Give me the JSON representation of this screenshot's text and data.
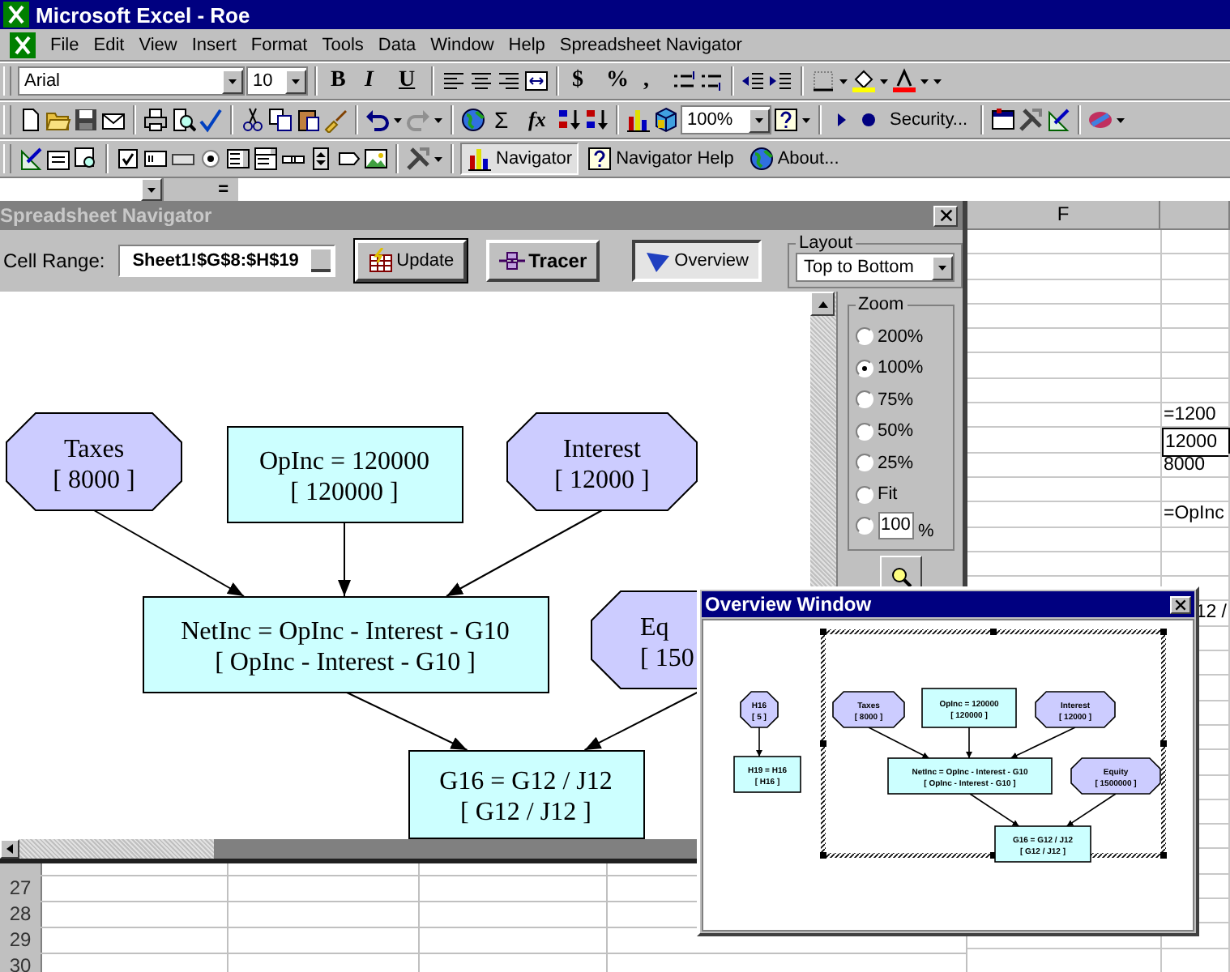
{
  "window": {
    "title": "Microsoft Excel - Roe"
  },
  "menu": [
    "File",
    "Edit",
    "View",
    "Insert",
    "Format",
    "Tools",
    "Data",
    "Window",
    "Help",
    "Spreadsheet Navigator"
  ],
  "toolbars": [
    {
      "items": [
        {
          "kind": "combo",
          "value": "Arial"
        },
        {
          "kind": "combo",
          "value": "10"
        },
        {
          "kind": "button",
          "label": "B"
        },
        {
          "kind": "button",
          "label": "I"
        },
        {
          "kind": "button",
          "label": "U"
        },
        {
          "kind": "button",
          "label": "$"
        },
        {
          "kind": "button",
          "label": "%"
        },
        {
          "kind": "button",
          "label": ","
        }
      ]
    },
    {
      "items": [
        {
          "kind": "button",
          "label": "Σ"
        },
        {
          "kind": "button",
          "label": "fx"
        },
        {
          "kind": "combo",
          "value": "100%"
        },
        {
          "kind": "button",
          "label": "Security..."
        }
      ]
    },
    {
      "items": [
        {
          "kind": "button",
          "label": "Navigator",
          "pressed": true
        },
        {
          "kind": "button",
          "label": "Navigator Help",
          "pressed": false
        },
        {
          "kind": "button",
          "label": "About...",
          "pressed": false
        }
      ]
    }
  ],
  "formula_bar": {
    "equals": "="
  },
  "navigator": {
    "title": "Spreadsheet Navigator",
    "cell_range": {
      "label": "Cell Range:",
      "value": "Sheet1!$G$8:$H$19"
    },
    "buttons": [
      {
        "label": "Update",
        "pressed": false
      },
      {
        "label": "Tracer",
        "pressed": false
      },
      {
        "label": "Overview",
        "pressed": true
      }
    ],
    "layout": {
      "legend": "Layout",
      "value": "Top to Bottom"
    },
    "zoom": {
      "legend": "Zoom",
      "options": [
        {
          "kind": "preset",
          "label": "200%",
          "selected": false
        },
        {
          "kind": "preset",
          "label": "100%",
          "selected": true
        },
        {
          "kind": "preset",
          "label": "75%",
          "selected": false
        },
        {
          "kind": "preset",
          "label": "50%",
          "selected": false
        },
        {
          "kind": "preset",
          "label": "25%",
          "selected": false
        },
        {
          "kind": "preset",
          "label": "Fit",
          "selected": false
        },
        {
          "kind": "custom",
          "value": "100",
          "unit": "%",
          "selected": false
        }
      ]
    },
    "nodes": [
      {
        "kind": "octagon",
        "lines": [
          "Taxes",
          "[ 8000 ]"
        ]
      },
      {
        "kind": "box",
        "lines": [
          "OpInc = 120000",
          "[ 120000 ]"
        ]
      },
      {
        "kind": "octagon",
        "lines": [
          "Interest",
          "[ 12000 ]"
        ]
      },
      {
        "kind": "box",
        "lines": [
          "NetInc = OpInc - Interest - G10",
          "[ OpInc - Interest - G10 ]"
        ]
      },
      {
        "kind": "octagon",
        "lines": [
          "Eq",
          "[ 150"
        ]
      },
      {
        "kind": "box",
        "lines": [
          "G16 = G12 / J12",
          "[ G12 / J12 ]"
        ]
      }
    ],
    "active": false
  },
  "sheet": {
    "column_headers": [
      "F"
    ],
    "rows": [
      {
        "selected": false
      },
      {
        "selected": false
      },
      {
        "selected": false
      },
      {
        "selected": false
      },
      {
        "selected": false
      },
      {
        "selected": false
      },
      {
        "selected": false
      },
      {
        "column_2": "=1200",
        "selected": false
      },
      {
        "column_2": "12000",
        "selected": true
      },
      {
        "column_2": "8000",
        "selected": false
      },
      {
        "selected": false
      },
      {
        "column_2": "=OpInc",
        "selected": false
      },
      {
        "selected": false
      },
      {
        "selected": false
      },
      {
        "selected": false
      },
      {
        "column_2": "12 /",
        "kind": "overflow",
        "selected": false
      }
    ]
  },
  "bottom_rows": [
    "27",
    "28",
    "29",
    "30"
  ],
  "overview_window": {
    "title": "Overview Window",
    "nodes": [
      {
        "kind": "octagon",
        "lines": [
          "H16",
          "[ 5 ]"
        ]
      },
      {
        "kind": "box",
        "lines": [
          "H19 = H16",
          "[ H16 ]"
        ]
      },
      {
        "kind": "octagon",
        "lines": [
          "Taxes",
          "[ 8000 ]"
        ]
      },
      {
        "kind": "box",
        "lines": [
          "OpInc = 120000",
          "[ 120000 ]"
        ]
      },
      {
        "kind": "octagon",
        "lines": [
          "Interest",
          "[ 12000 ]"
        ]
      },
      {
        "kind": "box",
        "lines": [
          "NetInc = OpInc - Interest - G10",
          "[ OpInc - Interest - G10 ]"
        ]
      },
      {
        "kind": "octagon",
        "lines": [
          "Equity",
          "[ 1500000 ]"
        ]
      },
      {
        "kind": "box",
        "lines": [
          "G16 = G12 / J12",
          "[ G12 / J12 ]"
        ]
      }
    ],
    "active": true
  }
}
